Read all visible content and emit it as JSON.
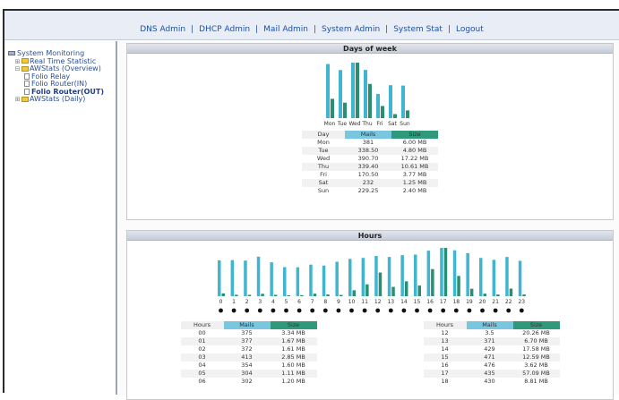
{
  "nav": {
    "links": [
      "DNS Admin",
      "DHCP Admin",
      "Mail Admin",
      "System Admin",
      "System Stat",
      "Logout"
    ],
    "separator": "|"
  },
  "sidebar": {
    "items": [
      {
        "label": "System Monitoring",
        "icon": "computer-icon"
      },
      {
        "label": "Real Time Statistic",
        "icon": "folder-icon"
      },
      {
        "label": "AWStats (Overview)",
        "icon": "folder-icon"
      },
      {
        "label": "Folio Relay",
        "icon": "document-icon"
      },
      {
        "label": "Folio Router(IN)",
        "icon": "document-icon"
      },
      {
        "label": "Folio Router(OUT)",
        "icon": "document-icon"
      },
      {
        "label": "AWStats (Daily)",
        "icon": "folder-icon"
      }
    ]
  },
  "days_panel": {
    "title": "Days of week",
    "chart_data": {
      "type": "bar",
      "categories": [
        "Mon",
        "Tue",
        "Wed",
        "Thu",
        "Fri",
        "Sat",
        "Sun"
      ],
      "series": [
        {
          "name": "Mails",
          "values": [
            381,
            338.5,
            390.7,
            339.4,
            170.5,
            232,
            229.25
          ],
          "color": "#3fb5cf"
        },
        {
          "name": "Size",
          "values": [
            6.0,
            4.8,
            17.22,
            10.61,
            3.77,
            1.25,
            2.4
          ],
          "color": "#2a8f72"
        }
      ]
    },
    "table": {
      "headers": [
        "Day",
        "Mails",
        "Size"
      ],
      "rows": [
        [
          "Mon",
          "381",
          "6.00 MB"
        ],
        [
          "Tue",
          "338.50",
          "4.80 MB"
        ],
        [
          "Wed",
          "390.70",
          "17.22 MB"
        ],
        [
          "Thu",
          "339.40",
          "10.61 MB"
        ],
        [
          "Fri",
          "170.50",
          "3.77 MB"
        ],
        [
          "Sat",
          "232",
          "1.25 MB"
        ],
        [
          "Sun",
          "229.25",
          "2.40 MB"
        ]
      ]
    }
  },
  "hours_panel": {
    "title": "Hours",
    "chart_data": {
      "type": "bar",
      "categories": [
        "0",
        "1",
        "2",
        "3",
        "4",
        "5",
        "6",
        "7",
        "8",
        "9",
        "10",
        "11",
        "12",
        "13",
        "14",
        "15",
        "16",
        "17",
        "18",
        "19",
        "20",
        "21",
        "22",
        "23"
      ],
      "series": [
        {
          "name": "Mails",
          "values": [
            375,
            377,
            372,
            413,
            354,
            304,
            302,
            330,
            320,
            360,
            390,
            400,
            420,
            410,
            429,
            435,
            476,
            505,
            480,
            450,
            400,
            380,
            410,
            370
          ],
          "color": "#3fb5cf"
        },
        {
          "name": "Size",
          "values": [
            3.34,
            1.67,
            1.61,
            2.85,
            1.6,
            1.11,
            1.2,
            3.0,
            2.0,
            1.5,
            7.0,
            14.0,
            28.0,
            11.0,
            17.58,
            12.59,
            32.0,
            57.09,
            24.0,
            8.81,
            3.0,
            2.0,
            9.0,
            2.0
          ],
          "color": "#2a8f72"
        }
      ]
    },
    "table_left": {
      "headers": [
        "Hours",
        "Mails",
        "Size"
      ],
      "rows": [
        [
          "00",
          "375",
          "3.34 MB"
        ],
        [
          "01",
          "377",
          "1.67 MB"
        ],
        [
          "02",
          "372",
          "1.61 MB"
        ],
        [
          "03",
          "413",
          "2.85 MB"
        ],
        [
          "04",
          "354",
          "1.60 MB"
        ],
        [
          "05",
          "304",
          "1.11 MB"
        ],
        [
          "06",
          "302",
          "1.20 MB"
        ]
      ]
    },
    "table_right": {
      "headers": [
        "Hours",
        "Mails",
        "Size"
      ],
      "rows": [
        [
          "12",
          "3.5",
          "20.26 MB"
        ],
        [
          "13",
          "371",
          "6.70 MB"
        ],
        [
          "14",
          "429",
          "17.58 MB"
        ],
        [
          "15",
          "471",
          "12.59 MB"
        ],
        [
          "16",
          "476",
          "3.62 MB"
        ],
        [
          "17",
          "435",
          "57.09 MB"
        ],
        [
          "18",
          "430",
          "8.81 MB"
        ]
      ]
    }
  }
}
